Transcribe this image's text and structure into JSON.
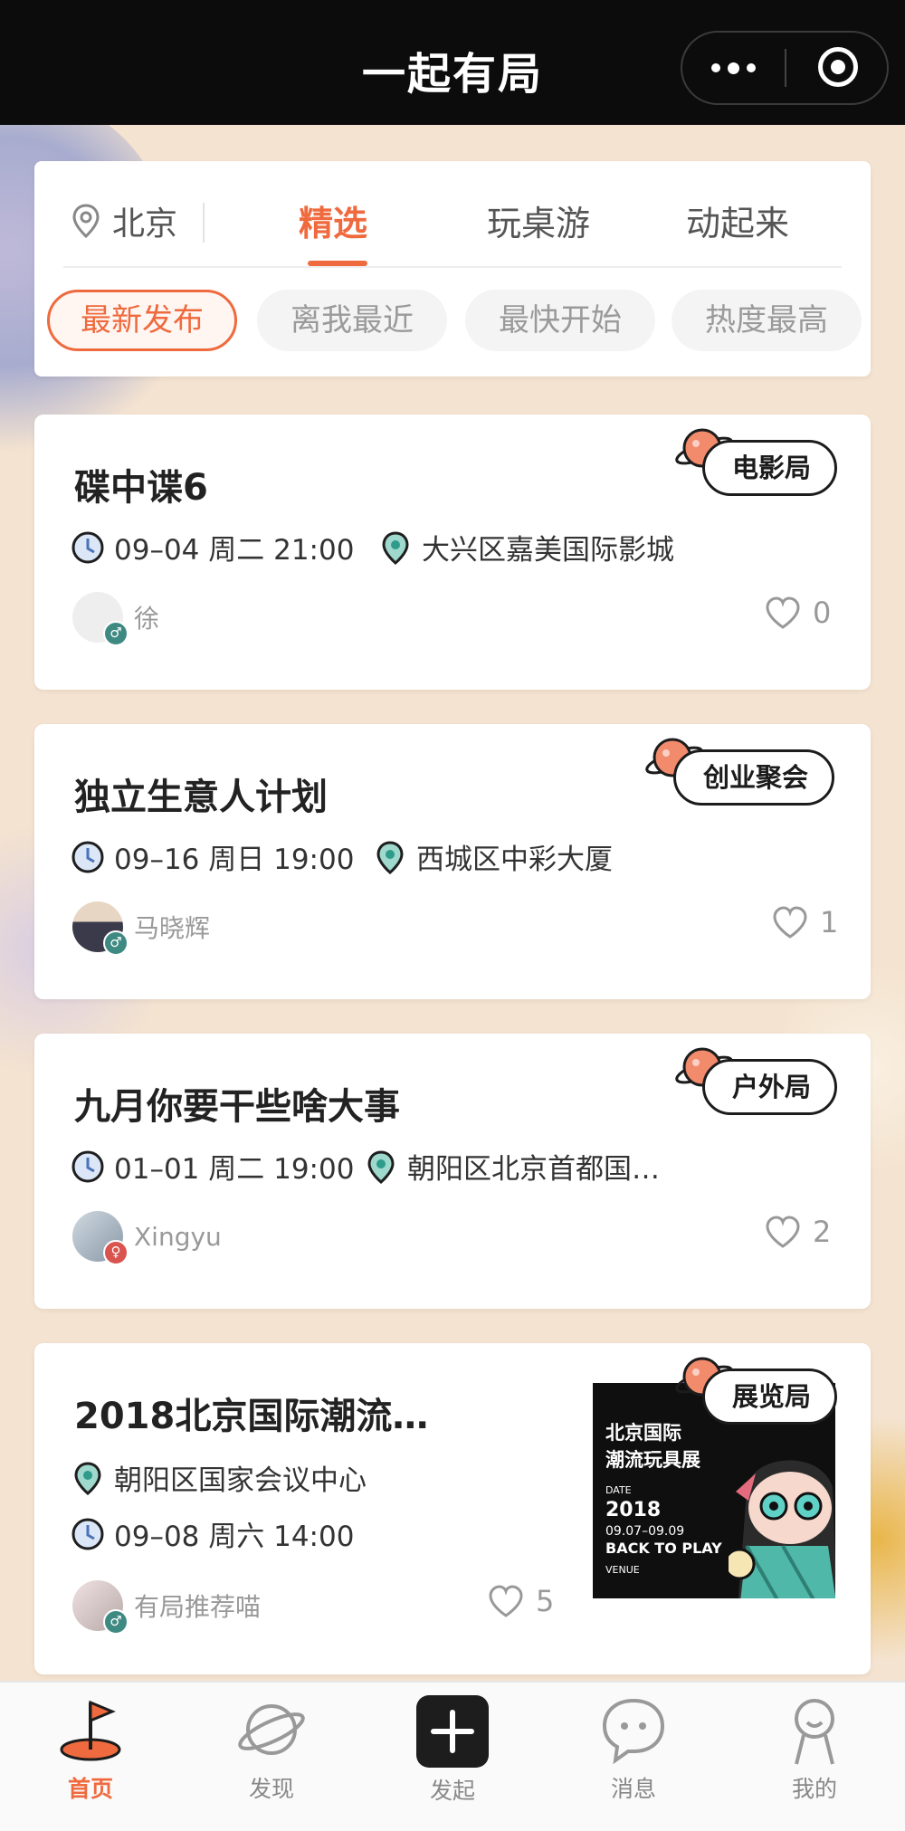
{
  "app": {
    "title": "一起有局"
  },
  "filter": {
    "city": "北京",
    "tabs": [
      {
        "label": "精选",
        "active": true
      },
      {
        "label": "玩桌游",
        "active": false
      },
      {
        "label": "动起来",
        "active": false
      }
    ],
    "sorts": [
      {
        "label": "最新发布",
        "active": true
      },
      {
        "label": "离我最近",
        "active": false
      },
      {
        "label": "最快开始",
        "active": false
      },
      {
        "label": "热度最高",
        "active": false
      }
    ]
  },
  "events": [
    {
      "title": "碟中谍6",
      "category": "电影局",
      "datetime": "09–04 周二 21:00",
      "location": "大兴区嘉美国际影城",
      "author": "徐",
      "likes": "0"
    },
    {
      "title": "独立生意人计划",
      "category": "创业聚会",
      "datetime": "09–16 周日 19:00",
      "location": "西城区中彩大厦",
      "author": "马晓辉",
      "likes": "1"
    },
    {
      "title": "九月你要干些啥大事",
      "category": "户外局",
      "datetime": "01–01 周二 19:00",
      "location": "朝阳区北京首都国…",
      "author": "Xingyu",
      "likes": "2"
    },
    {
      "title": "2018北京国际潮流…",
      "category": "展览局",
      "datetime": "09–08 周六 14:00",
      "location": "朝阳区国家会议中心",
      "author": "有局推荐喵",
      "likes": "5",
      "poster": {
        "title_line1": "北京国际",
        "title_line2": "潮流玩具展",
        "date_label": "DATE",
        "year": "2018",
        "range": "09.07–09.09",
        "tagline": "BACK TO PLAY",
        "venue_label": "VENUE"
      }
    }
  ],
  "nav": [
    {
      "label": "首页",
      "icon": "golf-flag-icon",
      "active": true
    },
    {
      "label": "发现",
      "icon": "planet-icon",
      "active": false
    },
    {
      "label": "发起",
      "icon": "plus-icon",
      "active": false
    },
    {
      "label": "消息",
      "icon": "chat-bubble-icon",
      "active": false
    },
    {
      "label": "我的",
      "icon": "profile-icon",
      "active": false
    }
  ],
  "colors": {
    "accent": "#ef6a3e",
    "topbar": "#0c0c0c",
    "badge_border": "#1c1c1c",
    "clock": "#4a72b8",
    "pin": "#2e9b8b"
  }
}
